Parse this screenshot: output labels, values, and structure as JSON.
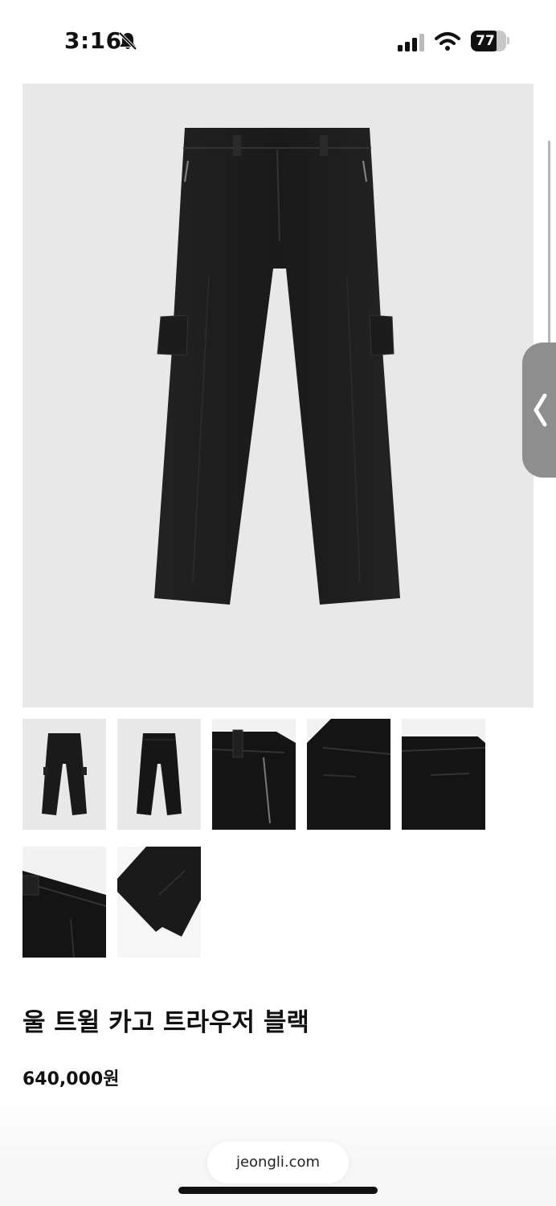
{
  "status": {
    "time": "3:16",
    "battery": "77",
    "icons": [
      "bell-slash-icon",
      "signal-icon",
      "wifi-icon",
      "battery-icon"
    ]
  },
  "gallery": {
    "main_image": "black-cargo-trousers-front",
    "thumbnails": [
      "trousers-front-thumb",
      "trousers-back-thumb",
      "waistband-zip-detail",
      "cargo-pocket-detail",
      "back-pocket-detail",
      "waistband-detail",
      "hem-detail"
    ],
    "side_handle_icon": "chevron-left-icon"
  },
  "product": {
    "title": "울 트윌 카고 트라우저 블랙",
    "price": "640,000원"
  },
  "browser": {
    "url": "jeongli.com"
  }
}
